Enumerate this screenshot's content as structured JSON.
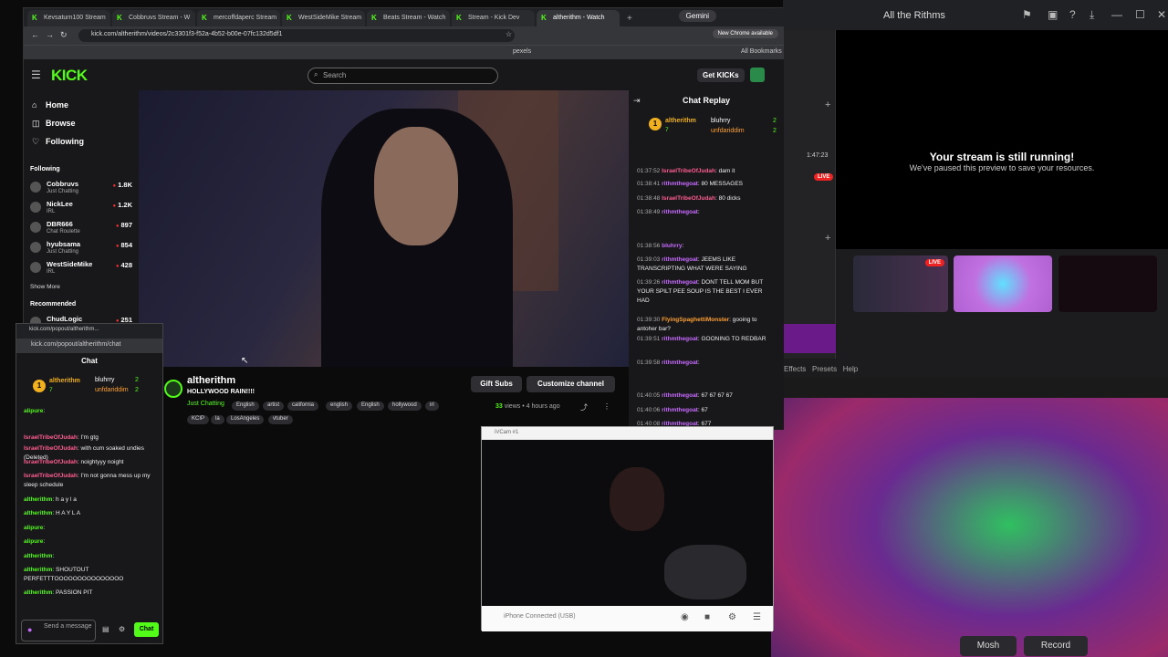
{
  "bg_right": {
    "title": "All the Rithms",
    "stream_running": "Your stream is still running!",
    "paused": "We've paused this preview to save your resources.",
    "timer": "1:47:23",
    "live": "LIVE",
    "live2": "LIVE",
    "menu": [
      "Effects",
      "Presets",
      "Help"
    ],
    "mosh": "Mosh",
    "record": "Record"
  },
  "browser": {
    "tabs": [
      "Kevsaturn100 Stream",
      "Cobbruvs Stream - W",
      "mercoffdaperc Stream",
      "WestSideMike Stream",
      "Beats Stream - Watch",
      "Stream - Kick Dev",
      "altherithm - Watch"
    ],
    "gemini": "Gemini",
    "url": "kick.com/altherithm/videos/2c3301f3-f52a-4b52-b00e-07fc132d5df1",
    "new_chrome": "New Chrome available",
    "bookmarks_pexels": "pexels",
    "all_bookmarks": "All Bookmarks"
  },
  "kick": {
    "logo": "KICK",
    "search_placeholder": "Search",
    "get_kicks": "Get KICKs",
    "nav": {
      "home": "Home",
      "browse": "Browse",
      "following": "Following"
    },
    "following_header": "Following",
    "following": [
      {
        "name": "Cobbruvs",
        "cat": "Just Chatting",
        "viewers": "1.8K"
      },
      {
        "name": "NickLee",
        "cat": "IRL",
        "viewers": "1.2K"
      },
      {
        "name": "DBR666",
        "cat": "Chat Roulette",
        "viewers": "897"
      },
      {
        "name": "hyubsama",
        "cat": "Just Chatting",
        "viewers": "854"
      },
      {
        "name": "WestSideMike",
        "cat": "IRL",
        "viewers": "428"
      }
    ],
    "show_more": "Show More",
    "recommended": "Recommended",
    "rec1": {
      "name": "ChudLogic",
      "viewers": "251"
    },
    "chat_replay": "Chat Replay",
    "leader": {
      "rank": "1",
      "name": "altherithm",
      "count": "7",
      "u2": "bluhrry",
      "c2": "2",
      "u3": "unfdariddim",
      "c3": "2"
    },
    "replay": [
      {
        "t": "01:37:52",
        "u": "IsraelTribeOfJudah",
        "m": "dam it",
        "c": "pink"
      },
      {
        "t": "01:38:41",
        "u": "rithmthegoat",
        "m": "80 MESSAGES",
        "c": "purple"
      },
      {
        "t": "01:38:48",
        "u": "IsraelTribeOfJudah",
        "m": "80 dicks",
        "c": "pink"
      },
      {
        "t": "01:38:49",
        "u": "rithmthegoat",
        "m": "",
        "c": "purple"
      },
      {
        "t": "01:38:56",
        "u": "bluhrry",
        "m": "",
        "c": "purple"
      },
      {
        "t": "01:39:03",
        "u": "rithmthegoat",
        "m": "JEEMS LIKE TRANSCRIPTING WHAT WERE SAYING",
        "c": "purple"
      },
      {
        "t": "01:39:26",
        "u": "rithmthegoat",
        "m": "DONT TELL MOM BUT YOUR SPILT PEE SOUP IS THE BEST I EVER HAD",
        "c": "purple"
      },
      {
        "t": "01:39:30",
        "u": "FlyingSpaghettiMonster",
        "m": "gooing to antoher bar?",
        "c": "orange"
      },
      {
        "t": "01:39:51",
        "u": "rithmthegoat",
        "m": "GOONING TO REDBAR",
        "c": "purple"
      },
      {
        "t": "01:39:58",
        "u": "rithmthegoat",
        "m": "",
        "c": "purple"
      },
      {
        "t": "01:40:05",
        "u": "rithmthegoat",
        "m": "67 67 67 67",
        "c": "purple"
      },
      {
        "t": "01:40:06",
        "u": "rithmthegoat",
        "m": "67",
        "c": "purple"
      },
      {
        "t": "01:40:08",
        "u": "rithmthegoat",
        "m": "677",
        "c": "purple"
      }
    ],
    "channel": "altherithm",
    "title": "HOLLYWOOD RAIN!!!!",
    "category": "Just Chatting",
    "tags": [
      "English",
      "artist",
      "california",
      "english",
      "English",
      "hollywood",
      "irl",
      "KCIP",
      "la",
      "LosAngeles",
      "vtuber"
    ],
    "gift_subs": "Gift Subs",
    "customize": "Customize channel",
    "views": "33",
    "views_label": "views",
    "ago": "4 hours ago"
  },
  "popout": {
    "title": "kick.com/popout/altherithm...",
    "url": "kick.com/popout/altherithm/chat",
    "header": "Chat",
    "msgs": [
      {
        "u": "alipure",
        "m": "",
        "c": "green"
      },
      {
        "u": "IsraelTribeOfJudah",
        "m": "I'm gtg",
        "c": "pink"
      },
      {
        "u": "IsraelTribeOfJudah",
        "m": "with cum soaked undies (Deleted)",
        "c": "pink"
      },
      {
        "u": "IsraelTribeOfJudah",
        "m": "noightyyy noight",
        "c": "pink"
      },
      {
        "u": "IsraelTribeOfJudah",
        "m": "I'm not gonna mess up my sleep schedule",
        "c": "pink"
      },
      {
        "u": "altherithm",
        "m": "h a y l a",
        "c": "green"
      },
      {
        "u": "altherithm",
        "m": "H A Y L A",
        "c": "green"
      },
      {
        "u": "alipure",
        "m": "",
        "c": "green"
      },
      {
        "u": "alipure",
        "m": "",
        "c": "green"
      },
      {
        "u": "altherithm",
        "m": "",
        "c": "green"
      },
      {
        "u": "altherithm",
        "m": "SHOUTOUT PERFETTTOOOOOOOOOOOOOOO",
        "c": "green"
      },
      {
        "u": "altherithm",
        "m": "PASSION PIT",
        "c": "green"
      }
    ],
    "send_placeholder": "Send a message",
    "chat_btn": "Chat"
  },
  "cam": {
    "title": "iVCam #1",
    "status": "iPhone Connected (USB)"
  }
}
